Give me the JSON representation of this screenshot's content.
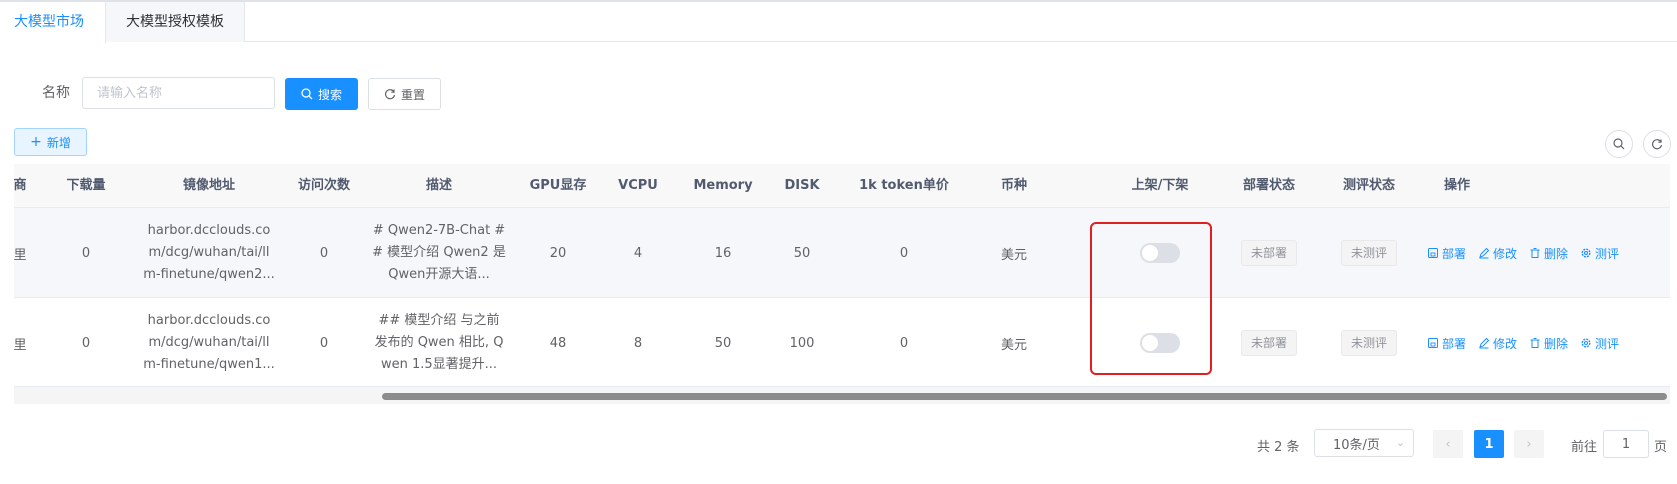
{
  "tabs": [
    {
      "label": "大模型市场",
      "active": true
    },
    {
      "label": "大模型授权模板",
      "active": false
    }
  ],
  "filter": {
    "name_label": "名称",
    "name_placeholder": "请输入名称",
    "search_label": "搜索",
    "reset_label": "重置"
  },
  "toolbar": {
    "add_label": "新增"
  },
  "table": {
    "headers": [
      "商",
      "下载量",
      "镜像地址",
      "访问次数",
      "描述",
      "GPU显存",
      "VCPU",
      "Memory",
      "DISK",
      "1k token单价",
      "币种",
      "上架/下架",
      "部署状态",
      "测评状态",
      "操作"
    ],
    "rows": [
      {
        "vendor": "里",
        "downloads": "0",
        "image_url": "harbor.dcclouds.co m/dcg/wuhan/tai/ll m-finetune/qwen2...",
        "visits": "0",
        "description": "# Qwen2-7B-Chat ## 模型介绍 Qwen2 是Qwen开源大语...",
        "gpu_mem": "20",
        "vcpu": "4",
        "memory": "16",
        "disk": "50",
        "token_price": "0",
        "currency": "美元",
        "listed": false,
        "deploy_status": "未部署",
        "eval_status": "未测评"
      },
      {
        "vendor": "里",
        "downloads": "0",
        "image_url": "harbor.dcclouds.co m/dcg/wuhan/tai/ll m-finetune/qwen1...",
        "visits": "0",
        "description": "## 模型介绍 与之前 发布的 Qwen 相比, Qwen 1.5显著提升...",
        "gpu_mem": "48",
        "vcpu": "8",
        "memory": "50",
        "disk": "100",
        "token_price": "0",
        "currency": "美元",
        "listed": false,
        "deploy_status": "未部署",
        "eval_status": "未测评"
      }
    ],
    "actions": {
      "deploy": "部署",
      "edit": "修改",
      "delete": "删除",
      "evaluate": "测评"
    }
  },
  "pagination": {
    "total_text": "共 2 条",
    "page_size": "10条/页",
    "current_page": "1",
    "goto_label": "前往",
    "goto_value": "1",
    "goto_unit": "页"
  },
  "colors": {
    "primary": "#1890ff",
    "highlight": "#e02020"
  }
}
